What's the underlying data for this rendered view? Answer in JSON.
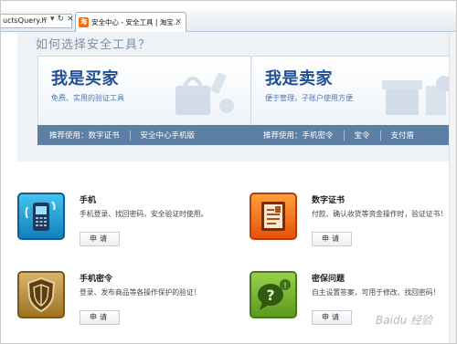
{
  "browser": {
    "address_text": "uctsQuery.h",
    "search_glyph": "⌕",
    "dropdown_glyph": "▾",
    "refresh_glyph": "↻",
    "stop_glyph": "×",
    "tab_favicon": "淘",
    "tab_title": "安全中心 - 安全工具 | 淘宝...",
    "tab_close": "×"
  },
  "main": {
    "section_title": "如何选择安全工具？",
    "buyer_card": {
      "title": "我是买家",
      "subtitle": "免费、实用的验证工具",
      "recommend_label": "推荐使用：",
      "links": [
        "数字证书",
        "安全中心手机版"
      ]
    },
    "seller_card": {
      "title": "我是卖家",
      "subtitle": "便于管理，子账户使用方便",
      "recommend_label": "推荐使用：",
      "links": [
        "手机密令",
        "宝令",
        "支付盾"
      ]
    },
    "products": [
      {
        "name": "手机",
        "desc": "手机登录、找回密码，安全验证时使用。",
        "button": "申请",
        "icon": "mobile-phone-icon"
      },
      {
        "name": "数字证书",
        "desc": "付款、确认收货等资金操作时，验证证书！",
        "button": "申请",
        "icon": "certificate-icon"
      },
      {
        "name": "手机密令",
        "desc": "登录、发布商品等各操作保护的验证！",
        "button": "申请",
        "icon": "shield-icon"
      },
      {
        "name": "密保问题",
        "desc": "自主设置答案，可用于修改、找回密码！",
        "button": "申请",
        "icon": "question-bubble-icon"
      }
    ]
  },
  "watermark": "Baidu 经验",
  "colors": {
    "accent_blue": "#1f4f95",
    "footer_bar": "#5d7fa4",
    "taobao_orange": "#ff6a00"
  }
}
